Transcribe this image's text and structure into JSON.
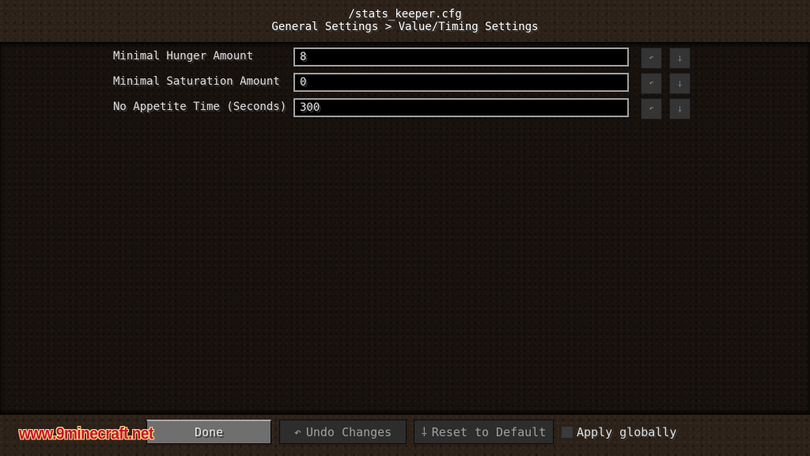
{
  "header": {
    "file": "/stats_keeper.cfg",
    "breadcrumb": "General Settings > Value/Timing Settings"
  },
  "entries": [
    {
      "label": "Minimal Hunger Amount",
      "value": "8"
    },
    {
      "label": "Minimal Saturation Amount",
      "value": "0"
    },
    {
      "label": "No Appetite Time (Seconds)",
      "value": "300"
    }
  ],
  "row_buttons": {
    "undo_icon": "↶",
    "reset_icon": "⸸"
  },
  "footer": {
    "done_label": "Done",
    "undo_label": "Undo Changes",
    "undo_icon": "↶",
    "reset_label": "Reset to Default",
    "reset_icon": "⸸",
    "apply_globally_label": "Apply globally",
    "apply_globally_checked": false
  },
  "watermark": "www.9minecraft.net"
}
